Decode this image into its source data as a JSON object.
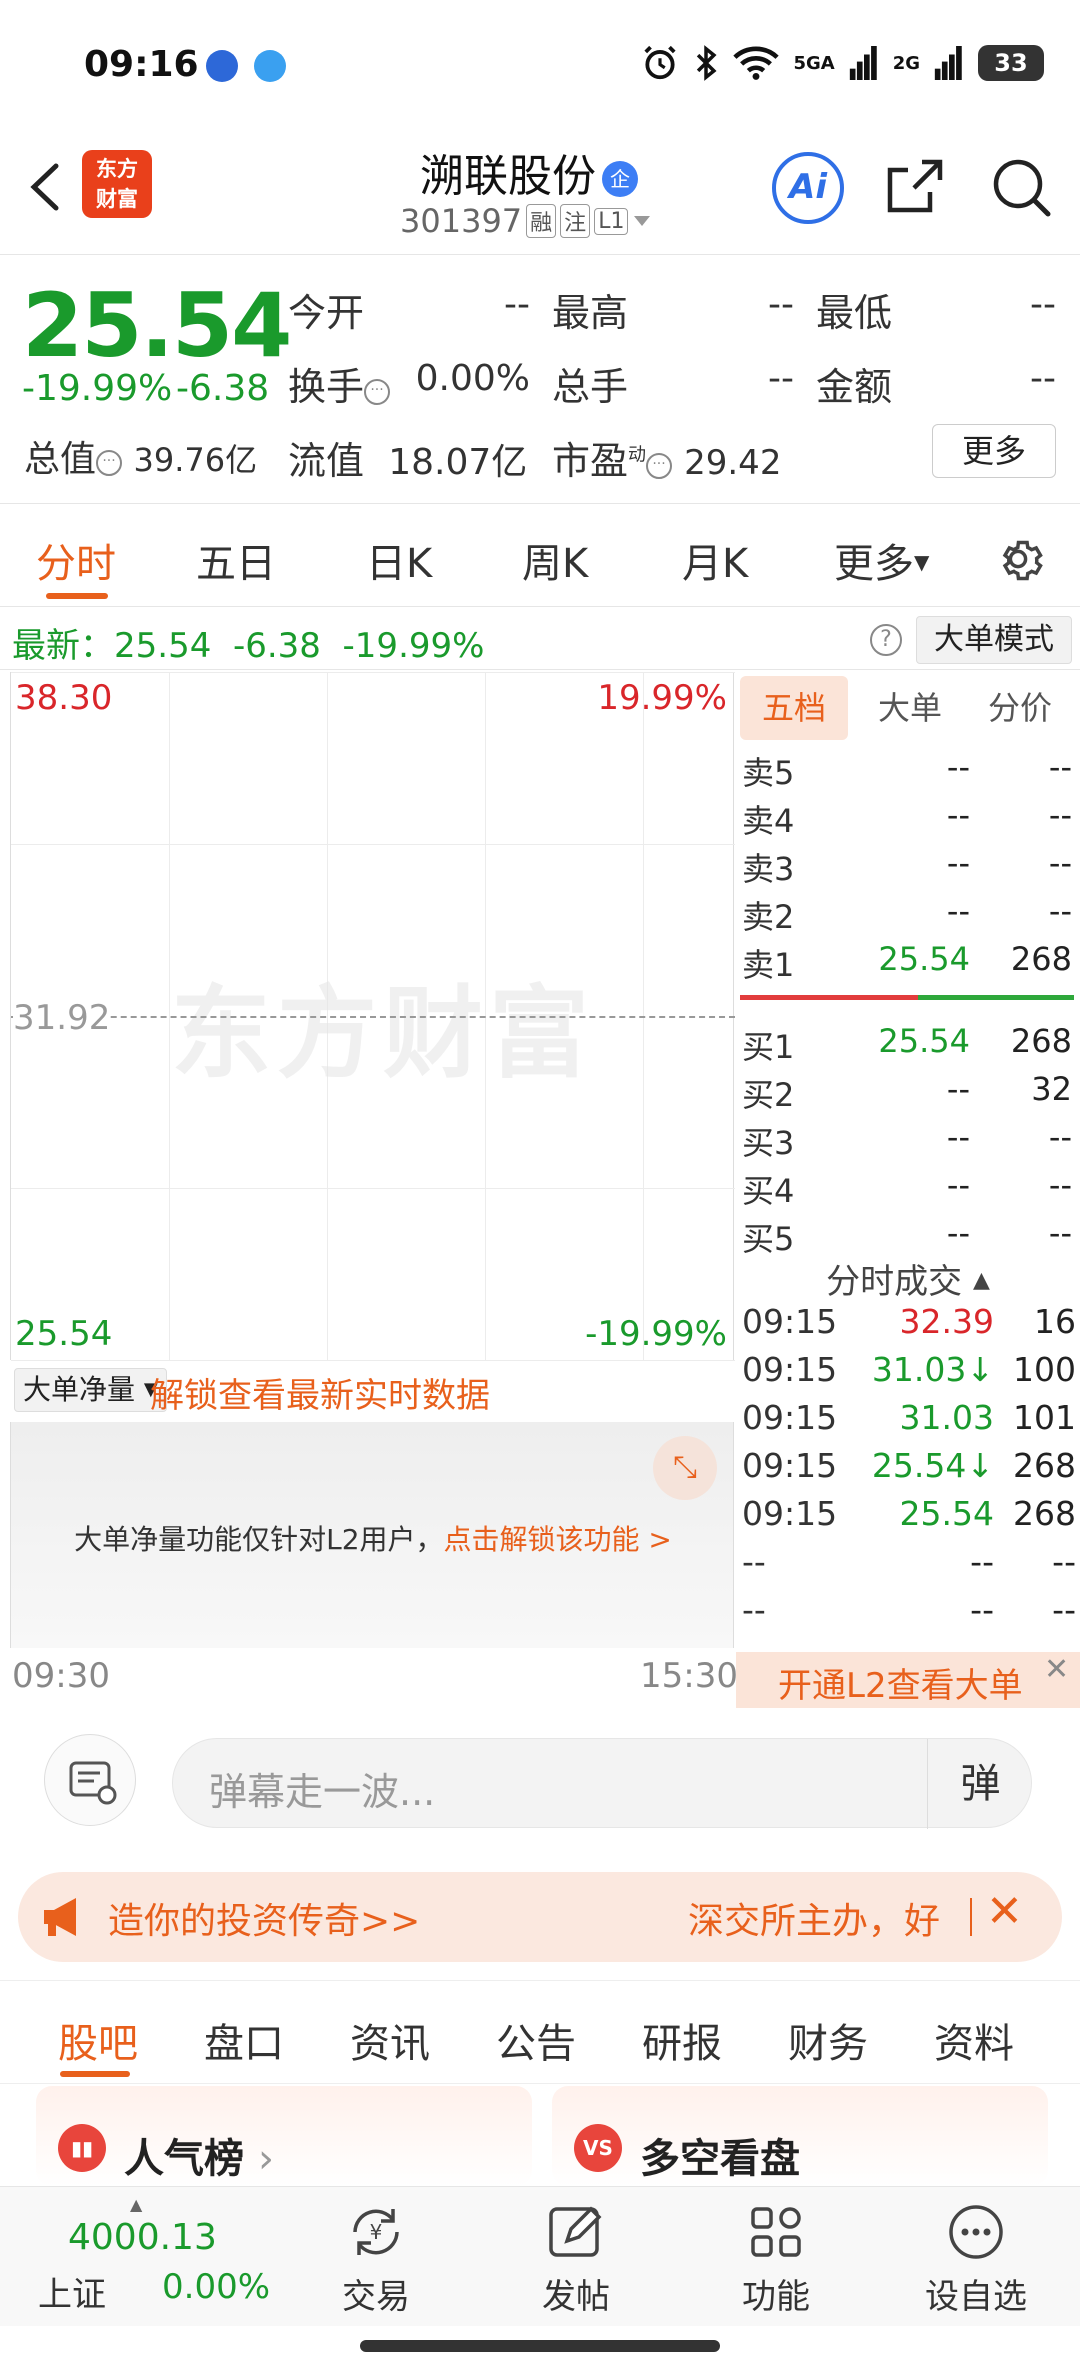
{
  "status_bar": {
    "time": "09:16",
    "network_1": "5GA",
    "network_2": "2G",
    "battery": "33"
  },
  "header": {
    "logo_text_1": "东方",
    "logo_text_2": "财富",
    "stock_name": "溯联股份",
    "name_badge": "企",
    "stock_code": "301397",
    "tag_1": "融",
    "tag_2": "注",
    "tag_3": "L1",
    "ai_label": "Ai"
  },
  "quote": {
    "price": "25.54",
    "change_pct": "-19.99%",
    "change": "-6.38",
    "open_label": "今开",
    "open_value": "--",
    "high_label": "最高",
    "high_value": "--",
    "low_label": "最低",
    "low_value": "--",
    "turnover_label": "换手",
    "turnover_value": "0.00%",
    "volume_label": "总手",
    "volume_value": "--",
    "amount_label": "金额",
    "amount_value": "--",
    "mktcap_label": "总值",
    "mktcap_value": "39.76亿",
    "float_label": "流值",
    "float_value": "18.07亿",
    "pe_label": "市盈",
    "pe_sup": "动",
    "pe_value": "29.42",
    "more_label": "更多"
  },
  "chart_tabs": [
    "分时",
    "五日",
    "日K",
    "周K",
    "月K",
    "更多"
  ],
  "latest": {
    "text": "最新：25.54  -6.38  -19.99%",
    "help": "?",
    "mode_label": "大单模式"
  },
  "chart": {
    "watermark": "东方财富",
    "high_price": "38.30",
    "high_pct": "19.99%",
    "mid_price": "31.92",
    "low_price": "25.54",
    "low_pct": "-19.99%",
    "time_start": "09:30",
    "time_end": "15:30"
  },
  "net_volume": {
    "select_label": "大单净量",
    "unlock_text": "解锁查看最新实时数据",
    "message": "大单净量功能仅针对L2用户，",
    "message_link": "点击解锁该功能 >"
  },
  "order_book": {
    "tabs": [
      "五档",
      "大单",
      "分价"
    ],
    "asks": [
      {
        "label": "卖5",
        "price": "--",
        "volume": "--"
      },
      {
        "label": "卖4",
        "price": "--",
        "volume": "--"
      },
      {
        "label": "卖3",
        "price": "--",
        "volume": "--"
      },
      {
        "label": "卖2",
        "price": "--",
        "volume": "--"
      },
      {
        "label": "卖1",
        "price": "25.54",
        "volume": "268"
      }
    ],
    "bids": [
      {
        "label": "买1",
        "price": "25.54",
        "volume": "268"
      },
      {
        "label": "买2",
        "price": "--",
        "volume": "32"
      },
      {
        "label": "买3",
        "price": "--",
        "volume": "--"
      },
      {
        "label": "买4",
        "price": "--",
        "volume": "--"
      },
      {
        "label": "买5",
        "price": "--",
        "volume": "--"
      }
    ],
    "trades_header": "分时成交",
    "trades": [
      {
        "time": "09:15",
        "price": "32.39",
        "volume": "16",
        "color": "#d9262a"
      },
      {
        "time": "09:15",
        "price": "31.03↓",
        "volume": "100",
        "color": "#1a9a2c"
      },
      {
        "time": "09:15",
        "price": "31.03",
        "volume": "101",
        "color": "#1a9a2c"
      },
      {
        "time": "09:15",
        "price": "25.54↓",
        "volume": "268",
        "color": "#1a9a2c"
      },
      {
        "time": "09:15",
        "price": "25.54",
        "volume": "268",
        "color": "#1a9a2c"
      },
      {
        "time": "--",
        "price": "--",
        "volume": "--",
        "color": "#222222"
      },
      {
        "time": "--",
        "price": "--",
        "volume": "--",
        "color": "#222222"
      }
    ],
    "l2_banner": "开通L2查看大单"
  },
  "comment": {
    "placeholder": "弹幕走一波...",
    "danmu_label": "弹"
  },
  "promo": {
    "left_text": "造你的投资传奇>>",
    "right_text": "深交所主办，好"
  },
  "section_tabs": [
    "股吧",
    "盘口",
    "资讯",
    "公告",
    "研报",
    "财务",
    "资料"
  ],
  "cards": [
    {
      "title": "人气榜",
      "icon": "hot-rank-icon"
    },
    {
      "title": "多空看盘",
      "icon": "vs-icon"
    }
  ],
  "bottom_nav": {
    "index_value": "4000.13",
    "index_name": "上证",
    "index_pct": "0.00%",
    "items": [
      "交易",
      "发帖",
      "功能",
      "设自选"
    ]
  },
  "colors": {
    "up": "#d9262a",
    "down": "#1a9a2c",
    "accent": "#e8601c"
  }
}
